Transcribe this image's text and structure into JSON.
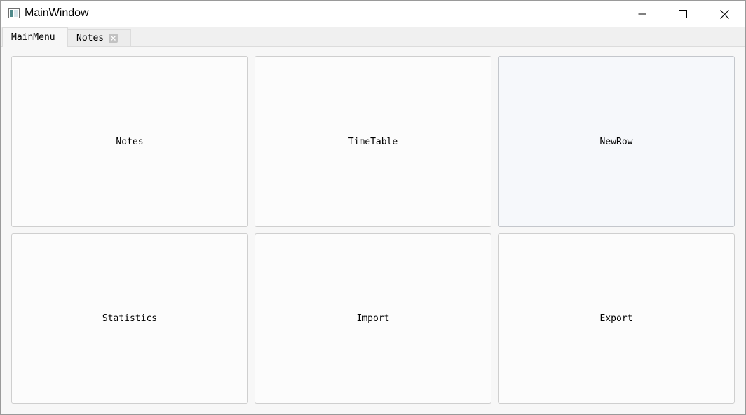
{
  "window": {
    "title": "MainWindow",
    "controls": {
      "minimize": "minimize-icon",
      "maximize": "maximize-icon",
      "close": "close-icon"
    }
  },
  "tabs": [
    {
      "label": "MainMenu",
      "active": true
    },
    {
      "label": "Notes",
      "active": false,
      "closable": true
    }
  ],
  "tiles": [
    {
      "label": "Notes"
    },
    {
      "label": "TimeTable"
    },
    {
      "label": "NewRow"
    },
    {
      "label": "Statistics"
    },
    {
      "label": "Import"
    },
    {
      "label": "Export"
    }
  ],
  "colors": {
    "titlebar": "#ffffff",
    "background": "#f0f0f0",
    "tile_background": "#fcfcfc",
    "tile_border": "#cfcfcf"
  }
}
